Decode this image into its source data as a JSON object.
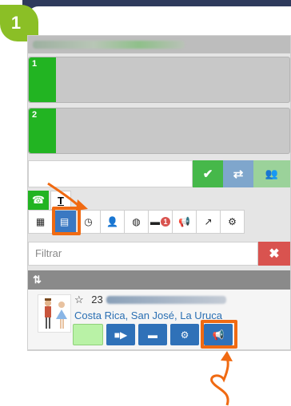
{
  "step": {
    "number": "1"
  },
  "colors": {
    "accent_orange": "#f06a12",
    "lane_green": "#22b422",
    "badge_green": "#8bbf26",
    "primary_blue": "#2f71b8",
    "danger_red": "#d9534f"
  },
  "lanes": [
    {
      "label": "1"
    },
    {
      "label": "2"
    }
  ],
  "dialer": {
    "value": "",
    "buttons": [
      {
        "icon": "check-icon",
        "glyph": "✔"
      },
      {
        "icon": "transfer-icon",
        "glyph": "⇄"
      },
      {
        "icon": "group-icon",
        "glyph": "👥"
      }
    ]
  },
  "mode_tabs": [
    {
      "icon": "phone-icon",
      "glyph": "☎"
    },
    {
      "icon": "text-icon",
      "glyph": "T"
    }
  ],
  "toolbar": {
    "tools": [
      {
        "icon": "grid-icon",
        "glyph": "▦"
      },
      {
        "icon": "contacts-list-icon",
        "glyph": "▤"
      },
      {
        "icon": "clock-icon",
        "glyph": "◷"
      },
      {
        "icon": "user-icon",
        "glyph": "👤"
      },
      {
        "icon": "globe-icon",
        "glyph": "◍"
      },
      {
        "icon": "chat-icon",
        "glyph": "▬"
      },
      {
        "icon": "megaphone-icon",
        "glyph": "📢"
      },
      {
        "icon": "share-icon",
        "glyph": "↗"
      },
      {
        "icon": "gear-icon",
        "glyph": "⚙"
      }
    ],
    "chat_badge": "1"
  },
  "filter": {
    "placeholder": "Filtrar",
    "clear_glyph": "✖"
  },
  "sort_bar": {
    "glyph": "⇅"
  },
  "contact": {
    "star": "☆",
    "number_prefix": "23",
    "location": "Costa Rica, San José, La Uruca",
    "actions": [
      {
        "icon": "video-icon",
        "glyph": "■▶"
      },
      {
        "icon": "message-icon",
        "glyph": "▬"
      },
      {
        "icon": "gear-icon",
        "glyph": "⚙"
      },
      {
        "icon": "megaphone-icon",
        "glyph": "📢"
      }
    ]
  }
}
